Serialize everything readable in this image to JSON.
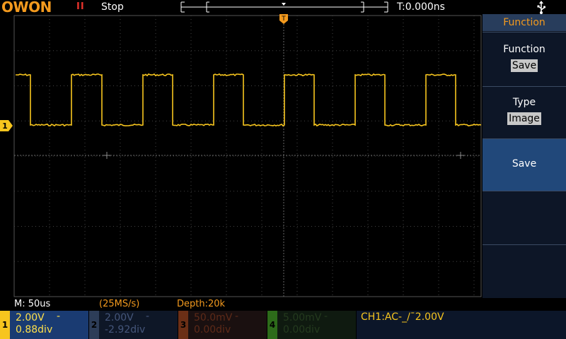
{
  "header": {
    "logo": "OWON",
    "run_state": "Stop",
    "time_offset": "T:0.000ns",
    "run_icon": "pause-icon",
    "usb_icon": "usb-icon"
  },
  "side_menu": {
    "title": "Function",
    "items": [
      {
        "label": "Function",
        "value": "Save"
      },
      {
        "label": "Type",
        "value": "Image"
      },
      {
        "label": "Save"
      }
    ]
  },
  "status": {
    "time_div": "M: 50us",
    "sample_rate": "(25MS/s)",
    "depth": "Depth:20k"
  },
  "channels": [
    {
      "num": "1",
      "scale": "2.00V",
      "pos": "0.88div",
      "coupling": "-",
      "color": "#f7c51e",
      "enabled": true
    },
    {
      "num": "2",
      "scale": "2.00V",
      "pos": "-2.92div",
      "coupling": "-",
      "color": "#45567a",
      "enabled": false
    },
    {
      "num": "3",
      "scale": "50.0mV",
      "pos": "0.00div",
      "coupling": "-",
      "color": "#6b2f16",
      "enabled": false
    },
    {
      "num": "4",
      "scale": "5.00mV",
      "pos": "0.00div",
      "coupling": "-",
      "color": "#2d6b1a",
      "enabled": false
    }
  ],
  "trigger": {
    "info": "CH1:AC-_/¯2.00V",
    "marker": "T"
  },
  "waveform": {
    "channel": "1",
    "shape": "square",
    "color": "#f7c51e"
  },
  "colors": {
    "accent": "#f39a1e",
    "ch1": "#f7c51e",
    "panel": "#1c2f4a",
    "grid": "#3a3a3a"
  }
}
